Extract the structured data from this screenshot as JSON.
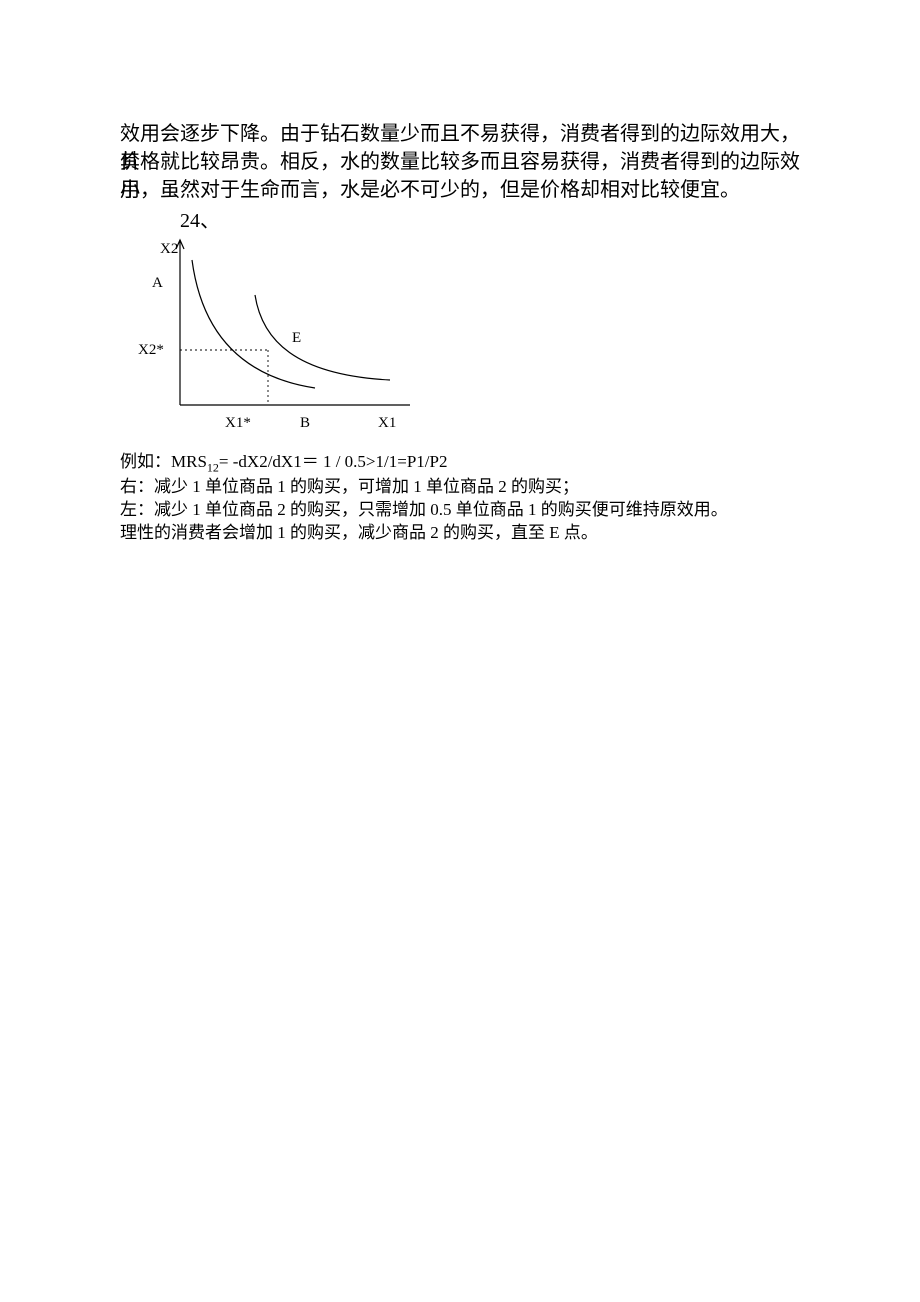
{
  "paragraph": {
    "line1": "效用会逐步下降。由于钻石数量少而且不易获得，消费者得到的边际效用大，其",
    "line2": "价格就比较昂贵。相反，水的数量比较多而且容易获得，消费者得到的边际效用",
    "line3": "小，虽然对于生命而言，水是必不可少的，但是价格却相对比较便宜。"
  },
  "q24": "24、",
  "chart": {
    "labels": {
      "y_axis_top": "X2",
      "A": "A",
      "y_star": "X2*",
      "E": "E",
      "x_star": "X1*",
      "B": "B",
      "x_axis_right": "X1"
    }
  },
  "chart_data": {
    "type": "line",
    "title": "",
    "xlabel": "X1",
    "ylabel": "X2",
    "series": [
      {
        "name": "Indifference curve (outer)",
        "description": "Convex downward-sloping curve; passes near E and approaches flat toward X-axis region"
      },
      {
        "name": "Indifference curve (inner)",
        "description": "Convex downward-sloping curve; passes through A and intersects region between X1* and B"
      },
      {
        "name": "Guideline to (X1*, X2*)",
        "description": "Dotted lines from axes to point (X1*, X2*)"
      }
    ],
    "annotations": [
      "A",
      "E",
      "X2*",
      "X1*",
      "B",
      "X1",
      "X2"
    ],
    "xlim": [
      "0",
      "X1"
    ],
    "ylim": [
      "0",
      "X2"
    ]
  },
  "notes": {
    "mrs_prefix": "例如：MRS",
    "mrs_sub": "12",
    "mrs_rest": "= -dX2/dX1＝ 1 / 0.5>1/1=P1/P2",
    "right": "右：减少 1 单位商品 1 的购买，可增加 1 单位商品 2 的购买；",
    "left": "左：减少 1 单位商品 2 的购买，只需增加 0.5 单位商品 1 的购买便可维持原效用。",
    "rational": "理性的消费者会增加 1 的购买，减少商品 2 的购买，直至 E 点。"
  }
}
